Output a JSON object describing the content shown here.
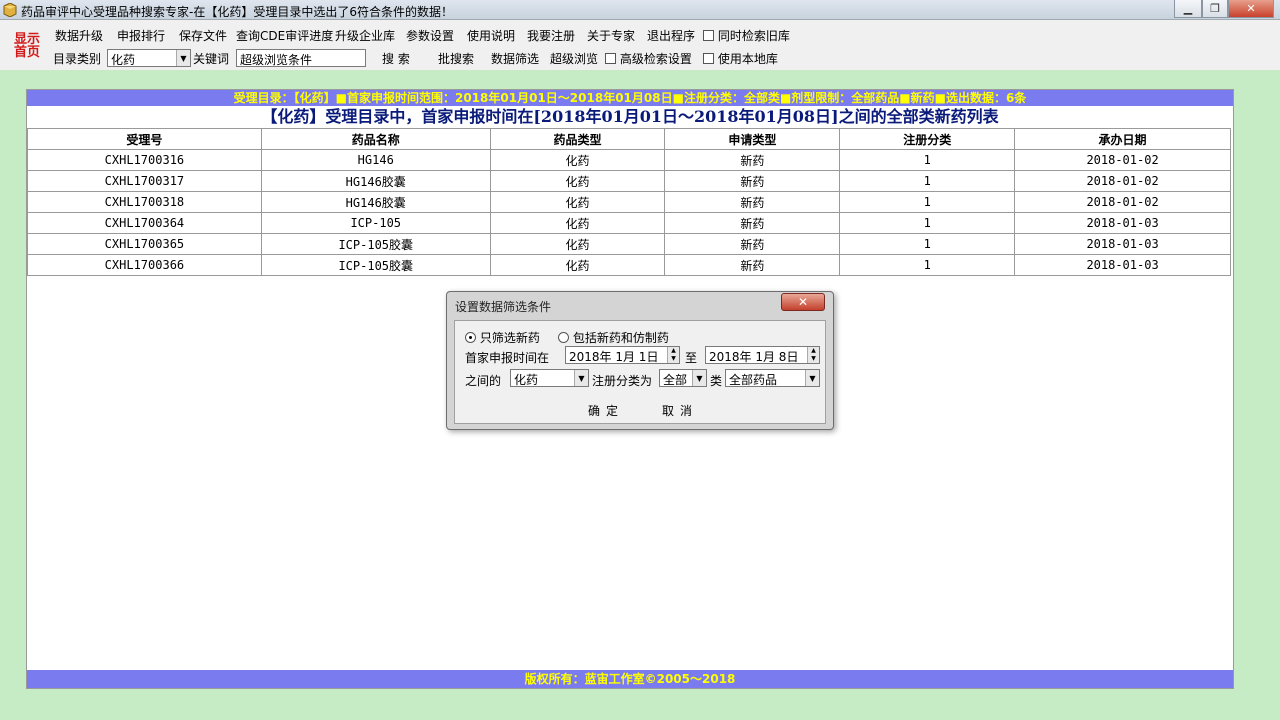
{
  "window": {
    "title": "药品审评中心受理品种搜索专家-在【化药】受理目录中选出了6符合条件的数据！"
  },
  "toolbar": {
    "home_logo": [
      "显示",
      "首页"
    ],
    "menu": [
      "数据升级",
      "申报排行",
      "保存文件",
      "查询CDE审评进度",
      "升级企业库",
      "参数设置",
      "使用说明",
      "我要注册",
      "关于专家",
      "退出程序"
    ],
    "search_old_label": "同时检索旧库",
    "category_label": "目录类别",
    "category_value": "化药",
    "keyword_label": "关键词",
    "keyword_value": "超级浏览条件",
    "search_button": "搜  索",
    "batch_search": "批搜索",
    "data_filter": "数据筛选",
    "super_browse": "超级浏览",
    "advanced_search_label": "高级检索设置",
    "use_local_label": "使用本地库"
  },
  "info_bar": "受理目录：【化药】■首家申报时间范围：2018年01月01日～2018年01月08日■注册分类：全部类■剂型限制：全部药品■新药■选出数据：6条",
  "list_title": "【化药】受理目录中，首家申报时间在[2018年01月01日～2018年01月08日]之间的全部类新药列表",
  "table": {
    "headers": [
      "受理号",
      "药品名称",
      "药品类型",
      "申请类型",
      "注册分类",
      "承办日期"
    ],
    "rows": [
      [
        "CXHL1700316",
        "HG146",
        "化药",
        "新药",
        "1",
        "2018-01-02"
      ],
      [
        "CXHL1700317",
        "HG146胶囊",
        "化药",
        "新药",
        "1",
        "2018-01-02"
      ],
      [
        "CXHL1700318",
        "HG146胶囊",
        "化药",
        "新药",
        "1",
        "2018-01-02"
      ],
      [
        "CXHL1700364",
        "ICP-105",
        "化药",
        "新药",
        "1",
        "2018-01-03"
      ],
      [
        "CXHL1700365",
        "ICP-105胶囊",
        "化药",
        "新药",
        "1",
        "2018-01-03"
      ],
      [
        "CXHL1700366",
        "ICP-105胶囊",
        "化药",
        "新药",
        "1",
        "2018-01-03"
      ]
    ]
  },
  "copyright": "版权所有：蓝宙工作室©2005～2018",
  "dialog": {
    "title": "设置数据筛选条件",
    "radio_new_only": "只筛选新药",
    "radio_include_generic": "包括新药和仿制药",
    "date_label": "首家申报时间在",
    "date_from": "2018年 1月 1日",
    "to_label": "至",
    "date_to": "2018年 1月 8日",
    "between_label": "之间的",
    "drug_type": "化药",
    "reg_class_label": "注册分类为",
    "reg_class": "全部",
    "class_label": "类",
    "dosage": "全部药品",
    "ok": "确定",
    "cancel": "取消"
  },
  "colors": {
    "frame_green": "#c6ecc6",
    "bar_blue": "#7b7bf0",
    "bar_text": "#ffff00",
    "title_navy": "#0a1a7a",
    "logo_red": "#d21a1a"
  }
}
